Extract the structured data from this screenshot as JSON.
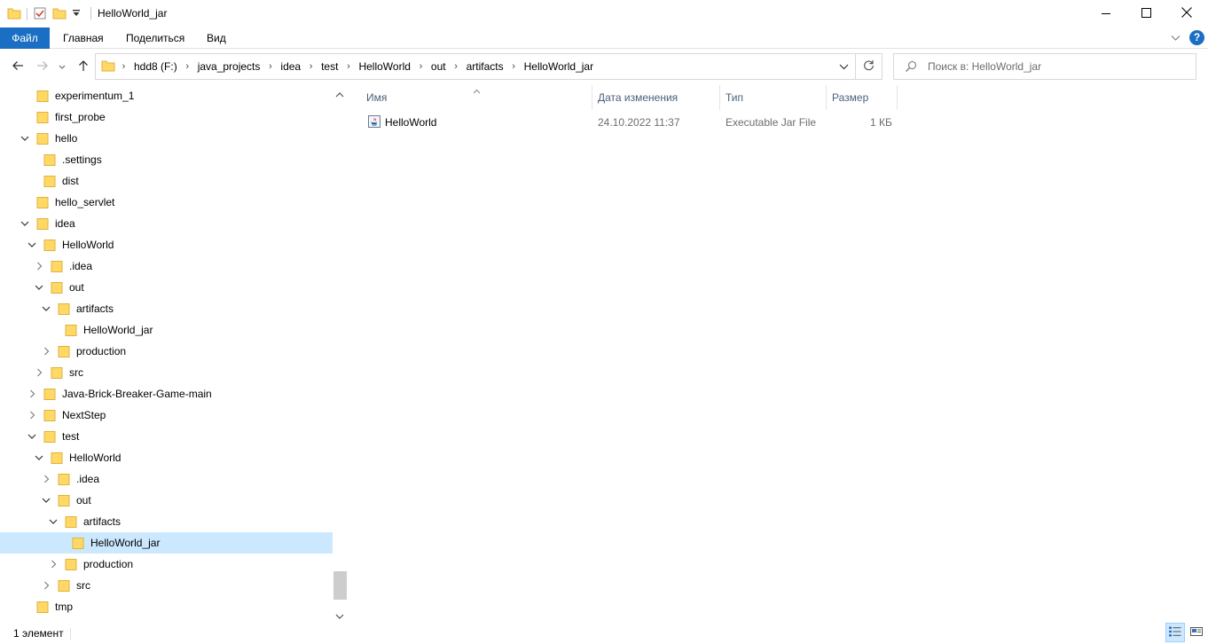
{
  "window": {
    "title": "HelloWorld_jar"
  },
  "ribbon": {
    "tabs": [
      "Файл",
      "Главная",
      "Поделиться",
      "Вид"
    ],
    "help": "?"
  },
  "address": {
    "crumbs": [
      "hdd8 (F:)",
      "java_projects",
      "idea",
      "test",
      "HelloWorld",
      "out",
      "artifacts",
      "HelloWorld_jar"
    ]
  },
  "search": {
    "placeholder": "Поиск в: HelloWorld_jar"
  },
  "tree": {
    "items": [
      {
        "label": "experimentum_1",
        "depth": 0,
        "expander": "none",
        "selected": false
      },
      {
        "label": "first_probe",
        "depth": 0,
        "expander": "none",
        "selected": false
      },
      {
        "label": "hello",
        "depth": 0,
        "expander": "expanded",
        "selected": false
      },
      {
        "label": ".settings",
        "depth": 1,
        "expander": "none",
        "selected": false
      },
      {
        "label": "dist",
        "depth": 1,
        "expander": "none",
        "selected": false
      },
      {
        "label": "hello_servlet",
        "depth": 0,
        "expander": "none",
        "selected": false
      },
      {
        "label": "idea",
        "depth": 0,
        "expander": "expanded",
        "selected": false
      },
      {
        "label": "HelloWorld",
        "depth": 1,
        "expander": "expanded",
        "selected": false
      },
      {
        "label": ".idea",
        "depth": 2,
        "expander": "collapsed",
        "selected": false
      },
      {
        "label": "out",
        "depth": 2,
        "expander": "expanded",
        "selected": false
      },
      {
        "label": "artifacts",
        "depth": 3,
        "expander": "expanded",
        "selected": false
      },
      {
        "label": "HelloWorld_jar",
        "depth": 4,
        "expander": "none",
        "selected": false
      },
      {
        "label": "production",
        "depth": 3,
        "expander": "collapsed",
        "selected": false
      },
      {
        "label": "src",
        "depth": 2,
        "expander": "collapsed",
        "selected": false
      },
      {
        "label": "Java-Brick-Breaker-Game-main",
        "depth": 1,
        "expander": "collapsed",
        "selected": false
      },
      {
        "label": "NextStep",
        "depth": 1,
        "expander": "collapsed",
        "selected": false
      },
      {
        "label": "test",
        "depth": 1,
        "expander": "expanded",
        "selected": false
      },
      {
        "label": "HelloWorld",
        "depth": 2,
        "expander": "expanded",
        "selected": false
      },
      {
        "label": ".idea",
        "depth": 3,
        "expander": "collapsed",
        "selected": false
      },
      {
        "label": "out",
        "depth": 3,
        "expander": "expanded",
        "selected": false
      },
      {
        "label": "artifacts",
        "depth": 4,
        "expander": "expanded",
        "selected": false
      },
      {
        "label": "HelloWorld_jar",
        "depth": 5,
        "expander": "none",
        "selected": true
      },
      {
        "label": "production",
        "depth": 4,
        "expander": "collapsed",
        "selected": false
      },
      {
        "label": "src",
        "depth": 3,
        "expander": "collapsed",
        "selected": false
      },
      {
        "label": "tmp",
        "depth": 0,
        "expander": "none",
        "selected": false
      }
    ]
  },
  "list": {
    "columns": {
      "name": "Имя",
      "date": "Дата изменения",
      "type": "Тип",
      "size": "Размер"
    },
    "files": [
      {
        "name": "HelloWorld",
        "date": "24.10.2022 11:37",
        "type": "Executable Jar File",
        "size": "1 КБ",
        "icon": "java-jar-icon"
      }
    ]
  },
  "status": {
    "count": "1 элемент"
  },
  "colors": {
    "accent": "#1a6ec3",
    "selection": "#cce8ff",
    "folder": "#ffd866",
    "folder_dark": "#e0b23c"
  }
}
